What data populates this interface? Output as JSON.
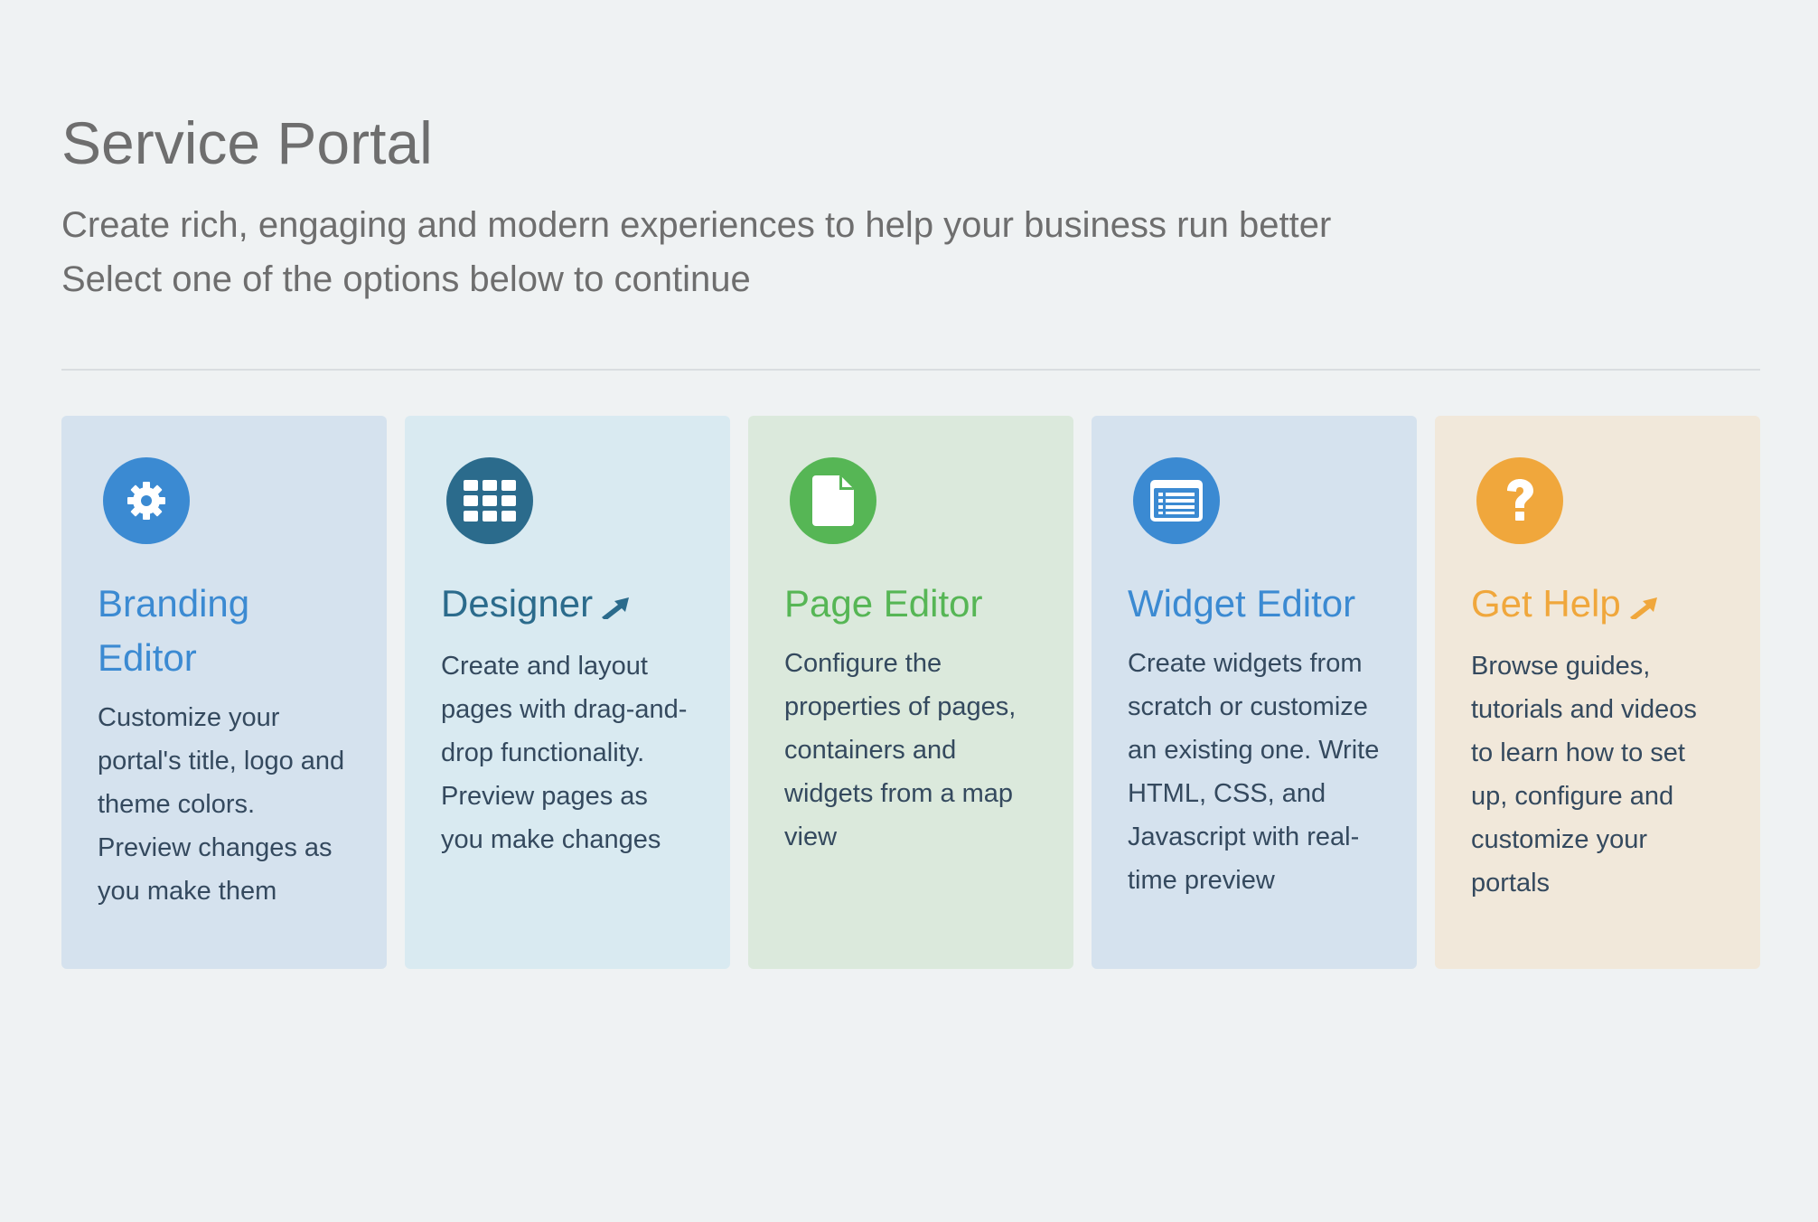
{
  "header": {
    "title": "Service Portal",
    "subtitle_line1": "Create rich, engaging and modern experiences to help your business run better",
    "subtitle_line2": "Select one of the options below to continue"
  },
  "cards": [
    {
      "title": "Branding Editor",
      "description": "Customize your portal's title, logo and theme colors. Preview changes as you make them",
      "icon": "gear-icon",
      "color": "#3b8ad2",
      "external": false
    },
    {
      "title": "Designer",
      "description": "Create and layout pages with drag-and-drop functionality. Preview pages as you make changes",
      "icon": "grid-icon",
      "color": "#2b6b8c",
      "external": true
    },
    {
      "title": "Page Editor",
      "description": "Configure the properties of pages, containers and widgets from a map view",
      "icon": "document-icon",
      "color": "#56b655",
      "external": false
    },
    {
      "title": "Widget Editor",
      "description": "Create widgets from scratch or customize an existing one. Write HTML, CSS, and Javascript with real-time preview",
      "icon": "list-window-icon",
      "color": "#3b8ad2",
      "external": false
    },
    {
      "title": "Get Help",
      "description": "Browse guides, tutorials and videos to learn how to set up, configure and customize your portals",
      "icon": "question-icon",
      "color": "#f0a73c",
      "external": true
    }
  ]
}
